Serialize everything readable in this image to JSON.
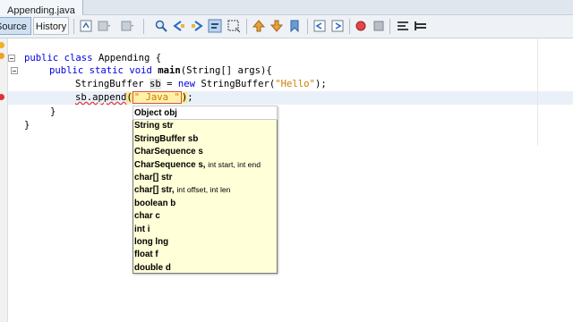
{
  "file_tab": {
    "label": "Appending.java"
  },
  "toolbar": {
    "source_label": "Source",
    "history_label": "History"
  },
  "code": {
    "line1": {
      "kw1": "public",
      "kw2": "class",
      "rest": " Appending {"
    },
    "line2": {
      "kw1": "public",
      "kw2": "static",
      "kw3": "void",
      "name": "main",
      "rest": "(String[] args){"
    },
    "line3": {
      "type": "StringBuffer",
      "var": "sb",
      "eq": " = ",
      "kw": "new",
      "ctor": " StringBuffer(",
      "arg": "\"Hello\"",
      "end": ");"
    },
    "line4": {
      "obj": "sb.append",
      "open": "(",
      "arg": "\" Java \"",
      "close": ")",
      "semi": ";"
    },
    "line5": {
      "brace": "}"
    },
    "line6": {
      "brace": "}"
    }
  },
  "completion": {
    "items": [
      {
        "main": "Object obj",
        "rest": ""
      },
      {
        "main": "String str",
        "rest": ""
      },
      {
        "main": "StringBuffer sb",
        "rest": ""
      },
      {
        "main": "CharSequence s",
        "rest": ""
      },
      {
        "main": "CharSequence s, ",
        "rest": "int start, int end"
      },
      {
        "main": "char[] str",
        "rest": ""
      },
      {
        "main": "char[] str, ",
        "rest": "int offset, int len"
      },
      {
        "main": "boolean b",
        "rest": ""
      },
      {
        "main": "char c",
        "rest": ""
      },
      {
        "main": "int i",
        "rest": ""
      },
      {
        "main": "long lng",
        "rest": ""
      },
      {
        "main": "float f",
        "rest": ""
      },
      {
        "main": "double d",
        "rest": ""
      }
    ]
  },
  "colors": {
    "keyword": "#0000e6",
    "string": "#ce7b00",
    "popup_bg": "#ffffd8",
    "error": "#e03030"
  }
}
